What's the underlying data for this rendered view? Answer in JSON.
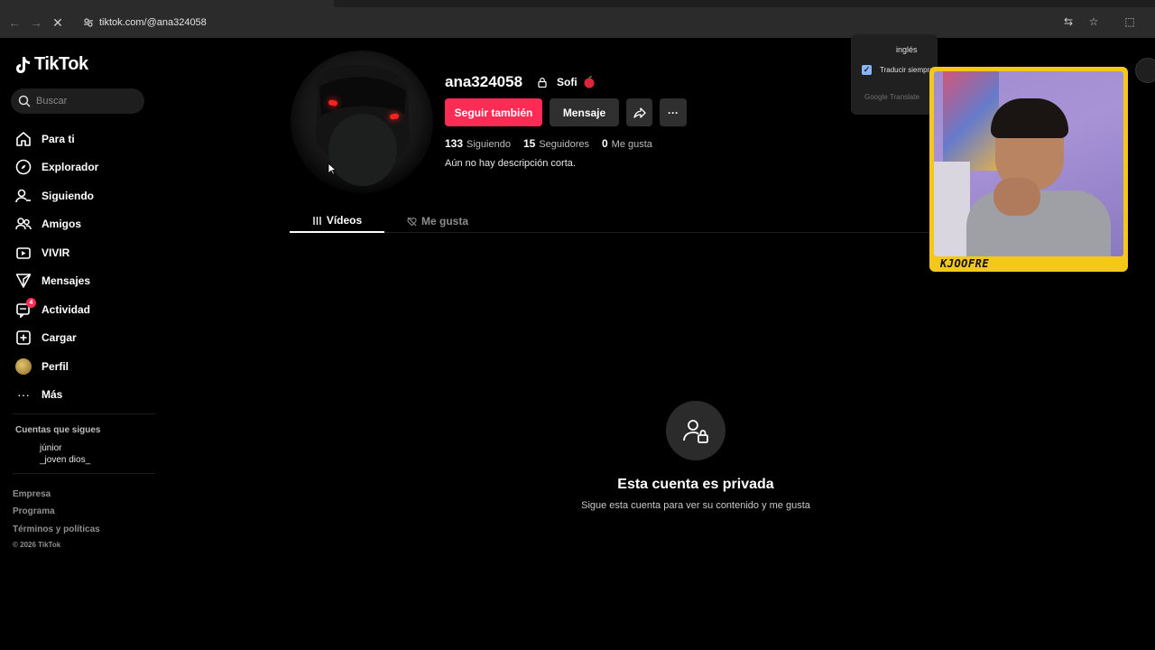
{
  "browser": {
    "url": "tiktok.com/@ana324058"
  },
  "sidebar": {
    "logo_text": "TikTok",
    "search_placeholder": "Buscar",
    "items": [
      {
        "label": "Para ti",
        "icon": "home-icon"
      },
      {
        "label": "Explorador",
        "icon": "compass-icon"
      },
      {
        "label": "Siguiendo",
        "icon": "user-follow-icon"
      },
      {
        "label": "Amigos",
        "icon": "friends-icon"
      },
      {
        "label": "VIVIR",
        "icon": "live-icon"
      },
      {
        "label": "Mensajes",
        "icon": "send-icon"
      },
      {
        "label": "Actividad",
        "icon": "activity-icon",
        "badge": "4"
      },
      {
        "label": "Cargar",
        "icon": "plus-square-icon"
      },
      {
        "label": "Perfil",
        "icon": "avatar"
      },
      {
        "label": "Más",
        "icon": "more-icon"
      }
    ],
    "following_title": "Cuentas que sigues",
    "following": [
      "júnior",
      "_joven dios_"
    ],
    "footer_links": [
      "Empresa",
      "Programa",
      "Términos y políticas"
    ],
    "copyright": "© 2026 TikTok"
  },
  "profile": {
    "username": "ana324058",
    "nickname": "Sofi",
    "follow_label": "Seguir también",
    "message_label": "Mensaje",
    "more_label": "···",
    "stats": [
      {
        "value": "133",
        "label": "Siguiendo"
      },
      {
        "value": "15",
        "label": "Seguidores"
      },
      {
        "value": "0",
        "label": "Me gusta"
      }
    ],
    "bio": "Aún no hay descripción corta."
  },
  "tabs": {
    "videos": "Vídeos",
    "likes": "Me gusta"
  },
  "private": {
    "title": "Esta cuenta es privada",
    "subtitle": "Sigue esta cuenta para ver su contenido y me gusta"
  },
  "translate_popup": {
    "language": "inglés",
    "always_label": "Traducir siempre",
    "provider": "Google Translate"
  },
  "webcam": {
    "name": "KJOOFRE"
  },
  "colors": {
    "accent": "#fe2c55",
    "background": "#000000",
    "webcam_frame": "#f3c81a"
  }
}
